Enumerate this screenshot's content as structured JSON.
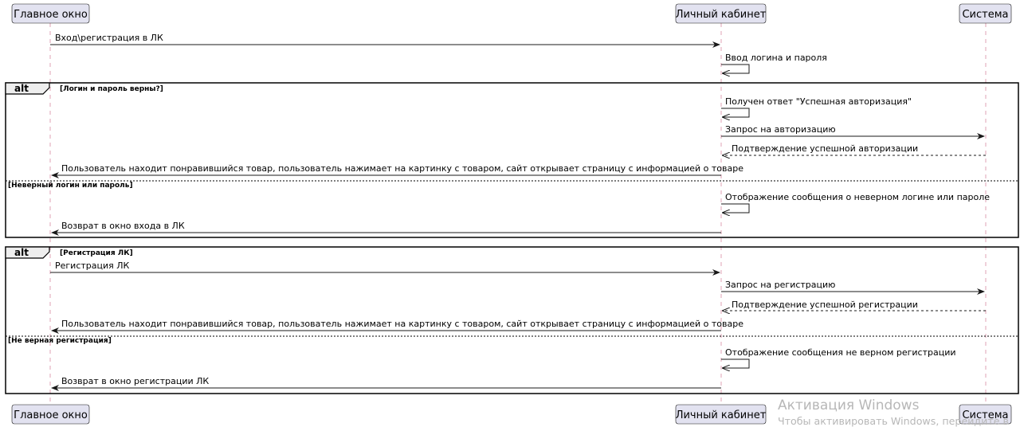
{
  "participants": {
    "main_window": "Главное окно",
    "cabinet": "Личный кабинет",
    "system": "Система"
  },
  "messages": {
    "m1": "Вход\\регистрация в ЛК",
    "m2": "Ввод логина и пароля",
    "alt1_m1": "Получен ответ \"Успешная авторизация\"",
    "alt1_m2": "Запрос на авторизацию",
    "alt1_m3": "Подтверждение успешной авторизации",
    "alt1_m4": "Пользователь находит понравившийся товар, пользователь нажимает на картинку с товаром, сайт открывает страницу с информацией о товаре",
    "alt1_e1": "Отображение сообщения о неверном логине или пароле",
    "alt1_e2": "Возврат в окно входа в ЛК",
    "alt2_m1": "Регистрация ЛК",
    "alt2_m2": "Запрос на регистрацию",
    "alt2_m3": "Подтверждение успешной регистрации",
    "alt2_m4": "Пользователь находит понравившийся товар, пользователь нажимает на картинку с товаром, сайт открывает страницу с информацией о товаре",
    "alt2_e1": "Отображение сообщения не верном регистрации",
    "alt2_e2": "Возврат в окно регистрации  ЛК"
  },
  "fragments": {
    "alt_label": "alt",
    "alt1_guard": "[Логин и пароль верны?]",
    "alt1_else_guard": "[Неверный логин или пароль]",
    "alt2_guard": "[Регистрация ЛК]",
    "alt2_else_guard": "[Не верная регистрация]"
  },
  "watermark": {
    "title": "Активация Windows",
    "subtitle": "Чтобы активировать Windows, перейдите в"
  }
}
